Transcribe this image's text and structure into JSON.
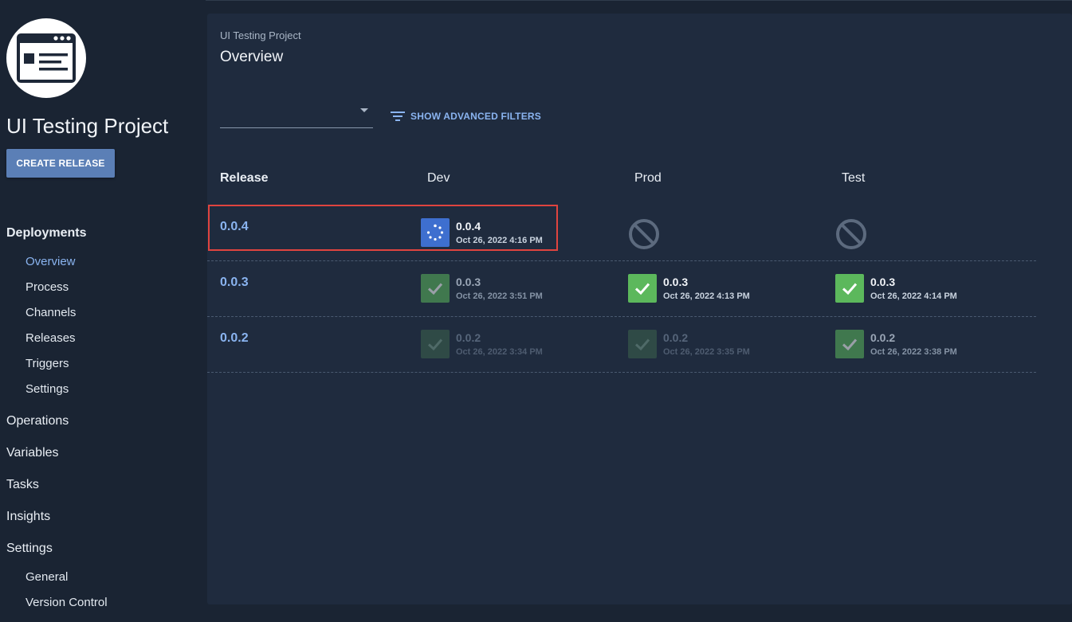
{
  "sidebar": {
    "project_name": "UI Testing Project",
    "create_release_label": "CREATE RELEASE",
    "nav": {
      "deployments": "Deployments",
      "deployments_items": [
        "Overview",
        "Process",
        "Channels",
        "Releases",
        "Triggers",
        "Settings"
      ],
      "operations": "Operations",
      "variables": "Variables",
      "tasks": "Tasks",
      "insights": "Insights",
      "settings": "Settings",
      "settings_items": [
        "General",
        "Version Control"
      ]
    },
    "active_item": "Overview"
  },
  "main": {
    "breadcrumb": "UI Testing Project",
    "title": "Overview",
    "channel_select_value": "",
    "advanced_filters_label": "SHOW ADVANCED FILTERS",
    "columns": [
      "Release",
      "Dev",
      "Prod",
      "Test"
    ],
    "rows": [
      {
        "release": "0.0.4",
        "dev": {
          "status": "running",
          "version": "0.0.4",
          "date": "Oct 26, 2022 4:16 PM"
        },
        "prod": {
          "status": "none"
        },
        "test": {
          "status": "none"
        }
      },
      {
        "release": "0.0.3",
        "dev": {
          "status": "success-previous",
          "version": "0.0.3",
          "date": "Oct 26, 2022 3:51 PM"
        },
        "prod": {
          "status": "success",
          "version": "0.0.3",
          "date": "Oct 26, 2022 4:13 PM"
        },
        "test": {
          "status": "success",
          "version": "0.0.3",
          "date": "Oct 26, 2022 4:14 PM"
        }
      },
      {
        "release": "0.0.2",
        "dev": {
          "status": "success-old",
          "version": "0.0.2",
          "date": "Oct 26, 2022 3:34 PM"
        },
        "prod": {
          "status": "success-old",
          "version": "0.0.2",
          "date": "Oct 26, 2022 3:35 PM"
        },
        "test": {
          "status": "success-previous",
          "version": "0.0.2",
          "date": "Oct 26, 2022 3:38 PM"
        }
      }
    ]
  },
  "colors": {
    "accent_link": "#8ab4f0",
    "success": "#5cb85c",
    "running": "#3e6fcf",
    "highlight_border": "#e0443f"
  },
  "icons": {
    "logo": "web-page-icon",
    "filter": "filter-lines-icon",
    "success": "check-icon",
    "running": "spinner-icon",
    "none": "no-entry-icon"
  }
}
